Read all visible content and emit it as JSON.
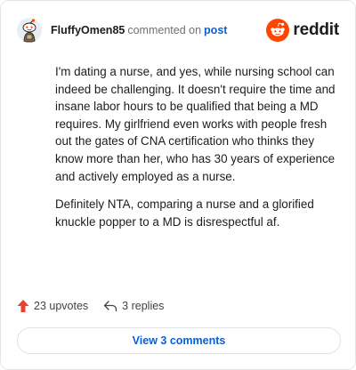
{
  "comment": {
    "username": "FluffyOmen85",
    "byline_text": "commented on",
    "post_link": "post",
    "brand": "reddit",
    "paragraphs": [
      "I'm dating a nurse, and yes, while nursing school can indeed be challenging. It doesn't require the time and insane labor hours to be qualified that being a MD requires. My girlfriend even works with people fresh out the gates of CNA certification who thinks they know more than her, who has 30 years of experience and actively employed as a nurse.",
      "Definitely NTA, comparing a nurse and a glorified knuckle popper to a MD is disrespectful af."
    ],
    "upvotes_label": "23 upvotes",
    "replies_label": "3 replies",
    "view_comments_label": "View 3 comments"
  },
  "colors": {
    "brand_orange": "#ff4500",
    "link_blue": "#0a5fd6",
    "upvote_red": "#e8432f"
  },
  "icons": {
    "avatar": "snoo-avatar-icon",
    "brand": "reddit-logo-icon",
    "upvote": "upvote-arrow-icon",
    "reply": "reply-arrow-icon"
  }
}
